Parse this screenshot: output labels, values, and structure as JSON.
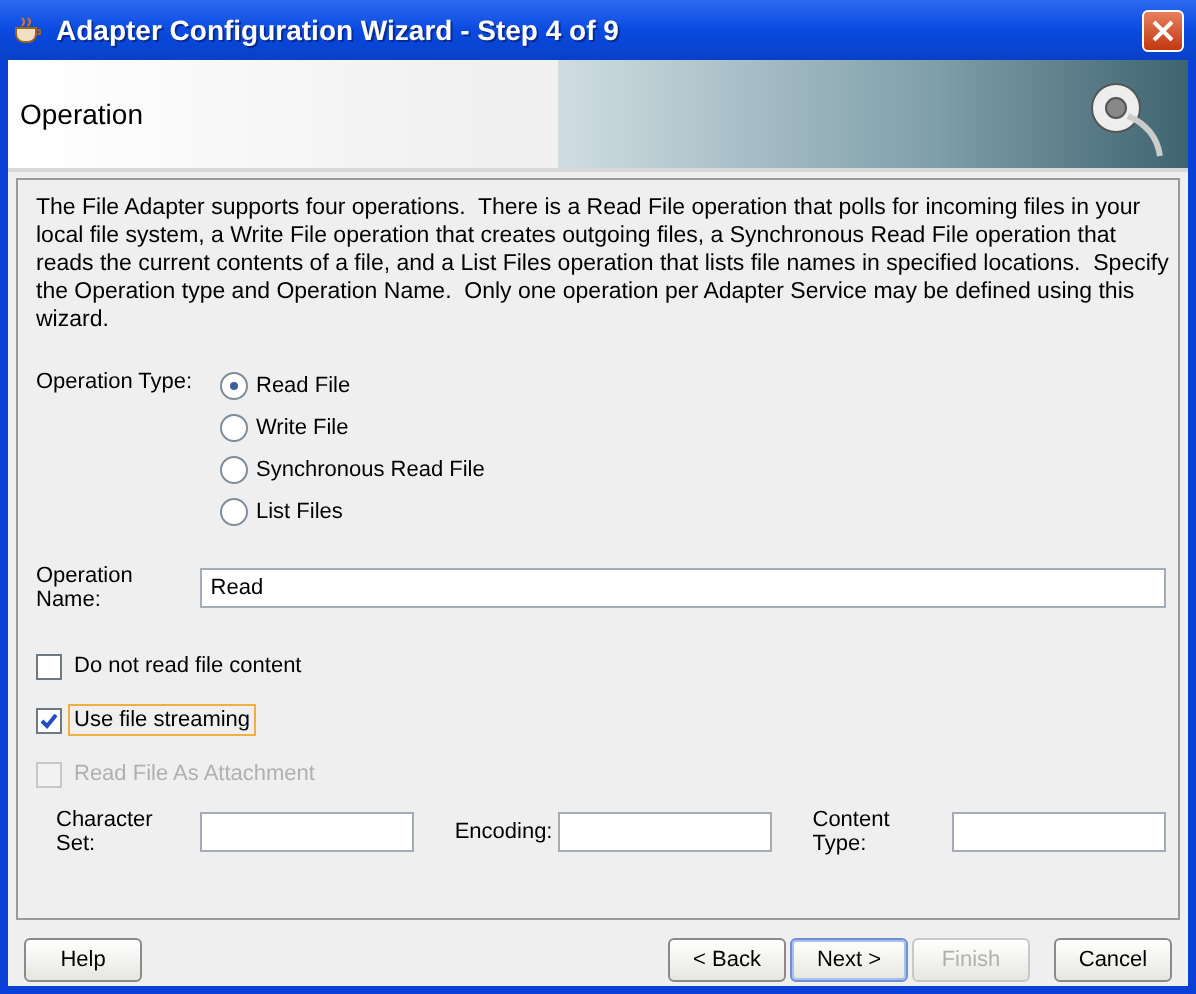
{
  "window": {
    "title": "Adapter Configuration Wizard - Step 4 of 9"
  },
  "header": {
    "title": "Operation"
  },
  "description": "The File Adapter supports four operations.  There is a Read File operation that polls for incoming files in your local file system, a Write File operation that creates outgoing files, a Synchronous Read File operation that reads the current contents of a file, and a List Files operation that lists file names in specified locations.  Specify the Operation type and Operation Name.  Only one operation per Adapter Service may be defined using this wizard.",
  "operation_type": {
    "label": "Operation Type:",
    "options": [
      {
        "label": "Read File",
        "selected": true
      },
      {
        "label": "Write File",
        "selected": false
      },
      {
        "label": "Synchronous Read File",
        "selected": false
      },
      {
        "label": "List Files",
        "selected": false
      }
    ]
  },
  "operation_name": {
    "label": "Operation Name:",
    "value": "Read"
  },
  "checkboxes": [
    {
      "label": "Do not read file content",
      "checked": false,
      "disabled": false,
      "focused": false
    },
    {
      "label": "Use file streaming",
      "checked": true,
      "disabled": false,
      "focused": true
    },
    {
      "label": "Read File As Attachment",
      "checked": false,
      "disabled": true,
      "focused": false
    }
  ],
  "attachment_fields": [
    {
      "label": "Character Set:"
    },
    {
      "label": "Encoding:"
    },
    {
      "label": "Content Type:"
    }
  ],
  "buttons": [
    {
      "label": "Help",
      "disabled": false,
      "default": false
    },
    {
      "label": "< Back",
      "disabled": false,
      "default": false
    },
    {
      "label": "Next >",
      "disabled": false,
      "default": true
    },
    {
      "label": "Finish",
      "disabled": true,
      "default": false
    },
    {
      "label": "Cancel",
      "disabled": false,
      "default": false
    }
  ]
}
